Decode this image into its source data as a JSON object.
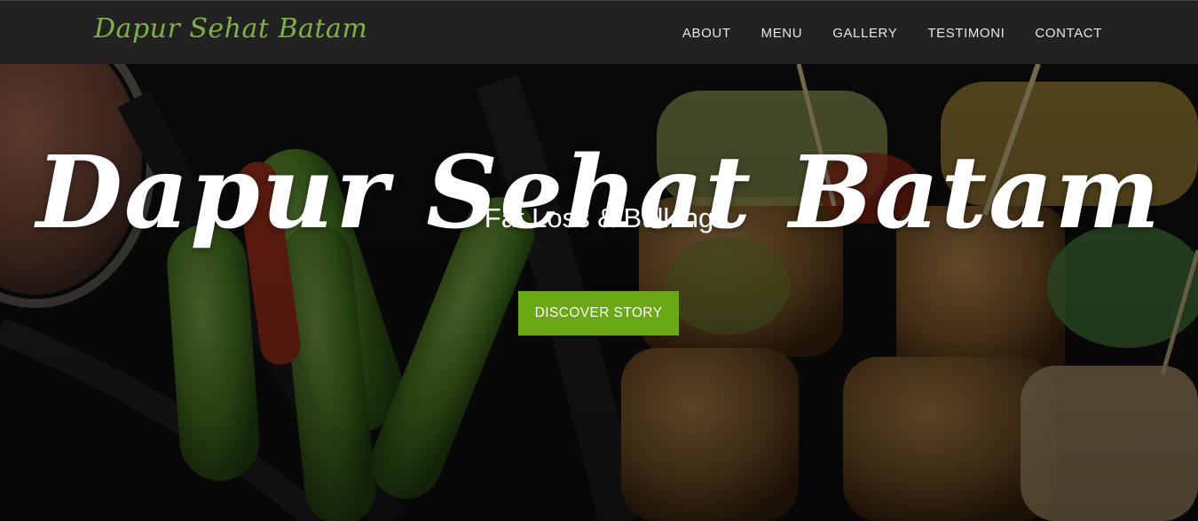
{
  "navbar": {
    "brand": "Dapur Sehat Batam",
    "links": [
      "ABOUT",
      "MENU",
      "GALLERY",
      "TESTIMONI",
      "CONTACT"
    ]
  },
  "hero": {
    "title": "Dapur Sehat Batam",
    "subtitle": "Fat Loss & Bulking",
    "cta_label": "DISCOVER STORY",
    "background_image": "food-photo"
  },
  "colors": {
    "navbar_bg": "#222222",
    "brand": "#7cb342",
    "cta_bg": "#6aa814",
    "nav_text": "#e6e6e6",
    "hero_text": "#ffffff"
  }
}
